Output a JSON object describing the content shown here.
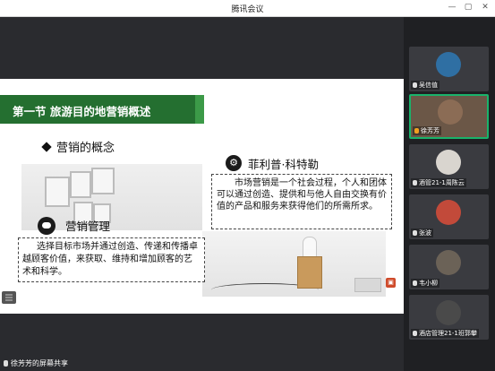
{
  "window": {
    "title": "腾讯会议",
    "minimize": "—",
    "maximize": "▢",
    "close": "✕"
  },
  "slide": {
    "title": "第一节  旅游目的地营销概述",
    "concept_heading": "营销的概念",
    "person_heading": "菲利普·科特勒",
    "definition": "市场营销是一个社会过程，个人和团体可以通过创造、提供和与他人自由交换有价值的产品和服务来获得他们的所需所求。",
    "mgmt_heading": "营销管理",
    "mgmt_text": "选择目标市场并通过创造、传递和传播卓越顾客价值，来获取、维持和增加顾客的艺术和科学。"
  },
  "participants": [
    {
      "name": "吴信值",
      "color": "#2f6fa3"
    },
    {
      "name": "徐芳芳",
      "color": "#8b6c55"
    },
    {
      "name": "酒管21-1周陈云",
      "color": "#d9d5cf"
    },
    {
      "name": "张波",
      "color": "#c24a3a"
    },
    {
      "name": "韦小柳",
      "color": "#6b6257"
    },
    {
      "name": "酒店管理21-1班郭攀",
      "color": "#4a4a4a"
    }
  ],
  "share": {
    "label": "徐芳芳的屏幕共享"
  }
}
